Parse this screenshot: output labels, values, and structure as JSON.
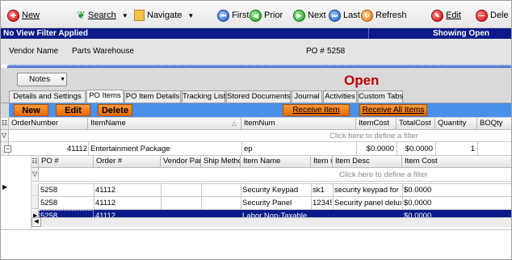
{
  "toolbar": {
    "new": "New",
    "search": "Search",
    "navigate": "Navigate",
    "first": "First",
    "prior": "Prior",
    "next": "Next",
    "last": "Last",
    "refresh": "Refresh",
    "edit": "Edit",
    "delete": "Dele"
  },
  "filterbar": {
    "left": "No View Filter Applied",
    "right": "Showing Open Purch"
  },
  "header": {
    "vendor_label": "Vendor Name",
    "vendor_value": "Parts Warehouse",
    "po_label": "PO #",
    "po_value": "5258"
  },
  "notes_button": "Notes",
  "status": "Open",
  "tabs": [
    {
      "label": "Details and Settings"
    },
    {
      "label": "PO Items"
    },
    {
      "label": "PO Item Details"
    },
    {
      "label": "Tracking List"
    },
    {
      "label": "Stored Documents"
    },
    {
      "label": "Journal"
    },
    {
      "label": "Activities"
    },
    {
      "label": "Custom Tabs"
    }
  ],
  "actions": {
    "new": "New",
    "edit": "Edit",
    "delete": "Delete",
    "receive_item": "Receive Item",
    "receive_all": "Receive All Items"
  },
  "master_grid": {
    "columns": [
      "OrderNumber",
      "ItemName",
      "ItemNum",
      "ItemCost",
      "TotalCost",
      "Quantity",
      "BOQty"
    ],
    "filter_hint": "Click here to define a filter",
    "row": {
      "order_number": "41112",
      "item_name": "Entertainment Package",
      "item_num": "ep",
      "item_cost": "$0.0000",
      "total_cost": "$0.0000",
      "quantity": "1"
    }
  },
  "detail_grid": {
    "columns": [
      "PO #",
      "Order #",
      "Vendor Part",
      "Ship Method",
      "Item Name",
      "Item #",
      "Item Desc",
      "Item Cost"
    ],
    "filter_hint": "Click here to define a filter",
    "rows": [
      {
        "po": "5258",
        "order": "41112",
        "vendor_part": "",
        "ship_method": "",
        "item_name": "Security Keypad",
        "item_num": "sk1",
        "item_desc": "security keypad for en",
        "item_cost": "$0.0000"
      },
      {
        "po": "5258",
        "order": "41112",
        "vendor_part": "",
        "ship_method": "",
        "item_name": "Security Panel",
        "item_num": "12345",
        "item_desc": "Security panel deluxe",
        "item_cost": "$0.0000"
      },
      {
        "po": "5258",
        "order": "41112",
        "vendor_part": "",
        "ship_method": "",
        "item_name": "Labor Non-Taxable",
        "item_num": "",
        "item_desc": "",
        "item_cost": "$0.0000"
      }
    ]
  },
  "colors": {
    "filterbar_bg": "#0a1a88",
    "action_bar_bg": "#4a8fe8",
    "orange_button": "#f07a10",
    "status_red": "#c00000",
    "selected_row": "#0a1a88"
  }
}
